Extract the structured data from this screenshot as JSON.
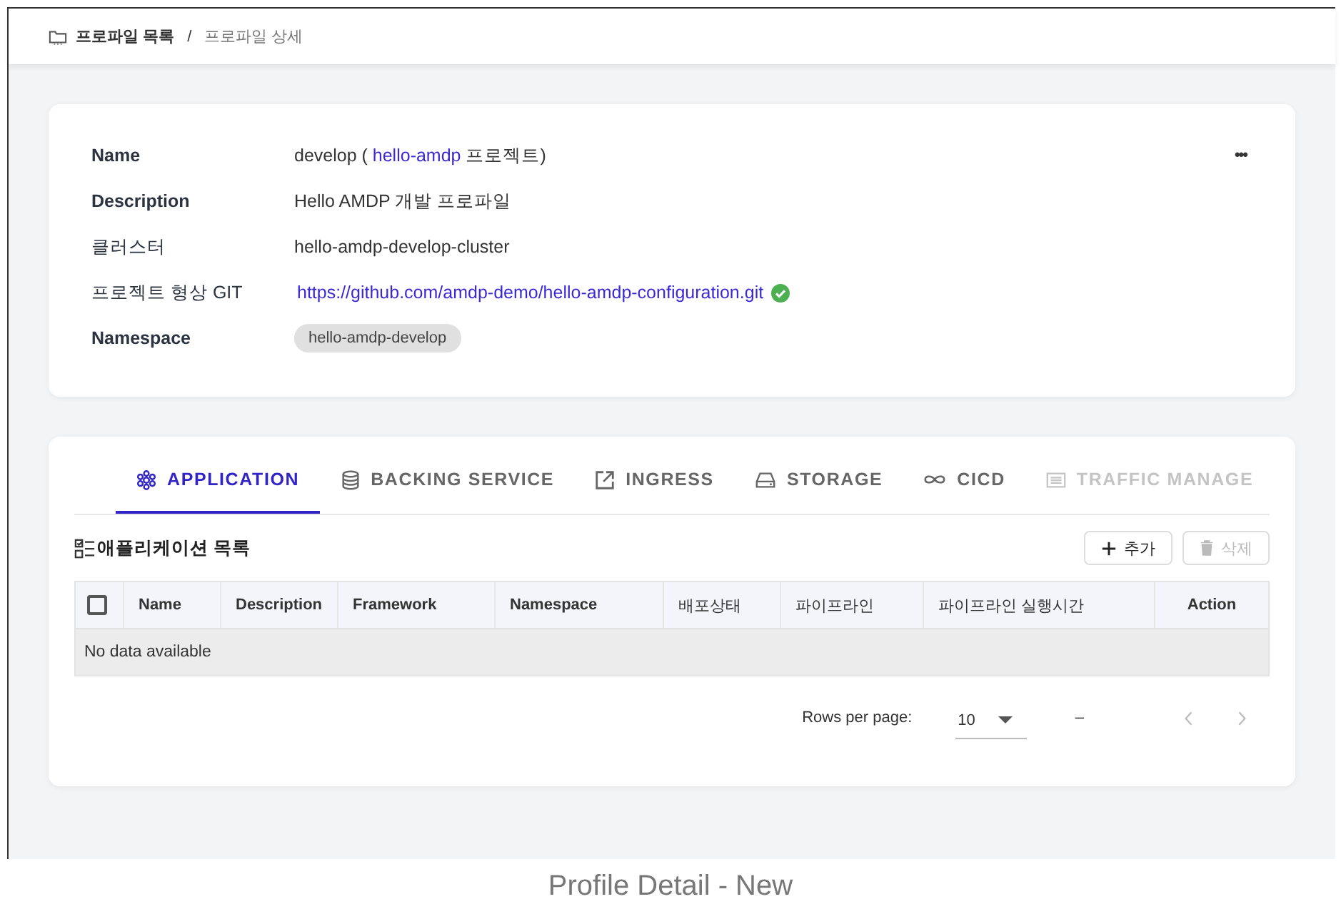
{
  "breadcrumb": {
    "separator": "/",
    "items": [
      {
        "label": "프로파일 목록",
        "current": false
      },
      {
        "label": "프로파일 상세",
        "current": true
      }
    ]
  },
  "profile": {
    "menu_icon": "•••",
    "fields": [
      {
        "kind": "name",
        "label": "Name",
        "before": "develop (",
        "link": "hello-amdp",
        "after": "프로젝트)"
      },
      {
        "kind": "text",
        "label": "Description",
        "value": "Hello AMDP 개발 프로파일"
      },
      {
        "kind": "text",
        "label": "클러스터",
        "value": "hello-amdp-develop-cluster"
      },
      {
        "kind": "link",
        "label": "프로젝트 형상 GIT",
        "value": "https://github.com/amdp-demo/hello-amdp-configuration.git",
        "verified": true
      },
      {
        "kind": "chip",
        "label": "Namespace",
        "value": "hello-amdp-develop"
      }
    ]
  },
  "tabs": [
    {
      "label": "APPLICATION",
      "kind": "app",
      "selected": true,
      "disabled": false
    },
    {
      "label": "BACKING SERVICE",
      "kind": "db",
      "selected": false,
      "disabled": false
    },
    {
      "label": "INGRESS",
      "kind": "ingress",
      "selected": false,
      "disabled": false
    },
    {
      "label": "STORAGE",
      "kind": "storage",
      "selected": false,
      "disabled": false
    },
    {
      "label": "CICD",
      "kind": "cicd",
      "selected": false,
      "disabled": false
    },
    {
      "label": "TRAFFIC MANAGE",
      "kind": "traffic",
      "selected": false,
      "disabled": true
    }
  ],
  "list": {
    "title": "애플리케이션 목록",
    "buttons": [
      {
        "label": "추가",
        "kind": "add",
        "disabled": false
      },
      {
        "label": "삭제",
        "kind": "delete",
        "disabled": true
      }
    ],
    "table": {
      "select_all": {
        "checked": false
      },
      "columns": [
        "Name",
        "Description",
        "Framework",
        "Namespace",
        "배포상태",
        "파이프라인",
        "파이프라인 실행시간",
        "Action"
      ],
      "empty_text": "No data available"
    },
    "pagination": {
      "rows_per_page_label": "Rows per page:",
      "rows_per_page": "10",
      "range": "–",
      "prev_disabled": true,
      "next_disabled": true
    }
  },
  "caption": "Profile Detail - New"
}
